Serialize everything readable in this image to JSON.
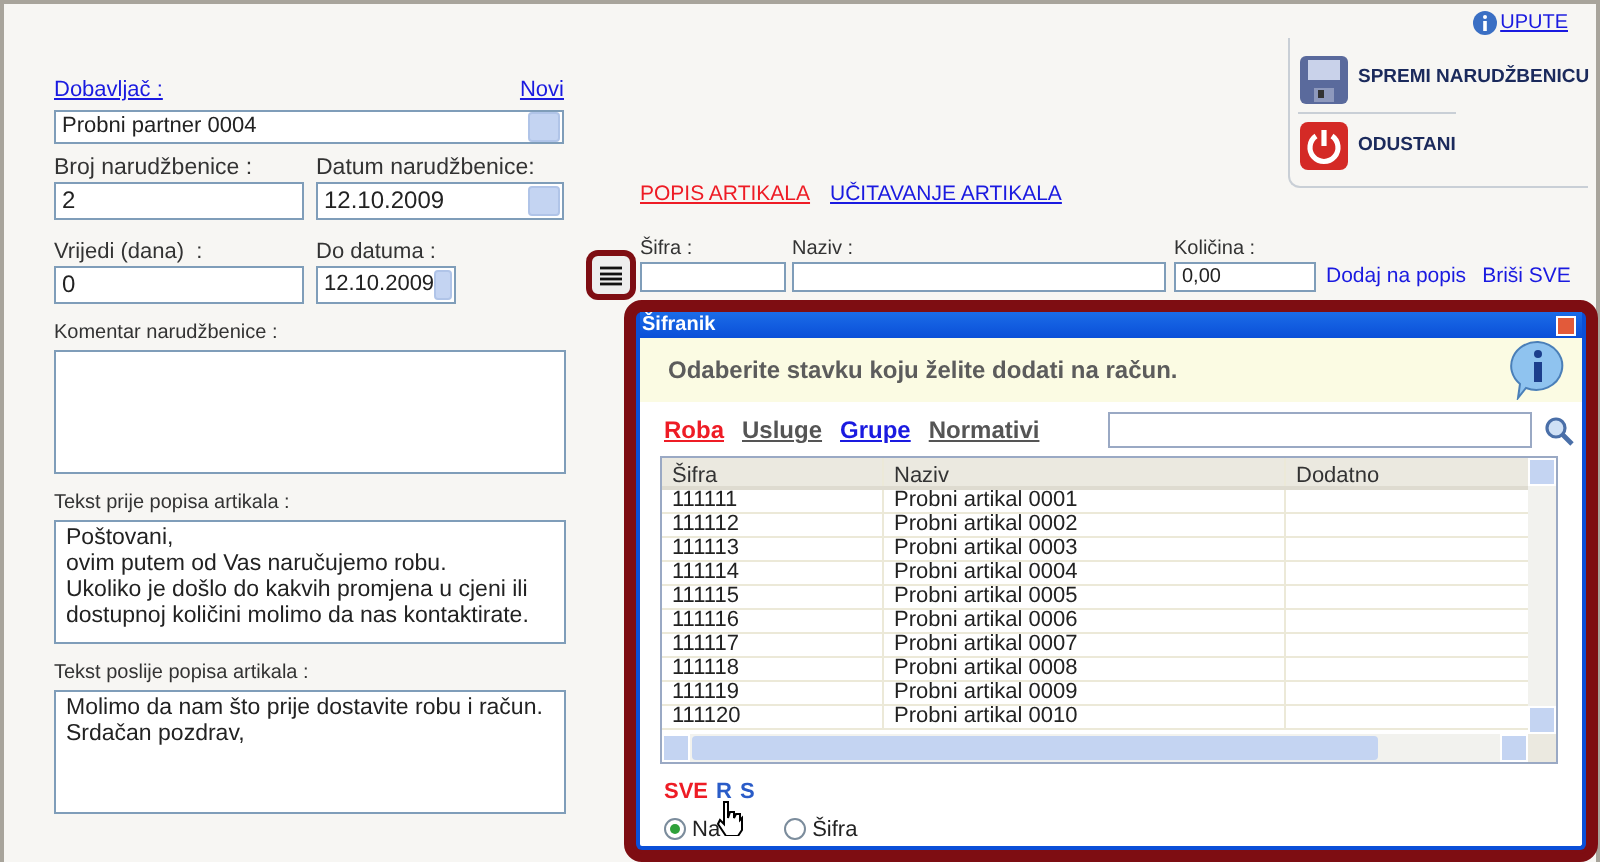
{
  "help_link": "UPUTE",
  "actions": [
    {
      "kind": "save",
      "label": "SPREMI NARUDŽBENICU"
    },
    {
      "kind": "cancel",
      "label": "ODUSTANI"
    }
  ],
  "supplier": {
    "label": "Dobavljač :",
    "new_link": "Novi",
    "value": "Probni partner 0004"
  },
  "order_number": {
    "label": "Broj narudžbenice :",
    "value": "2"
  },
  "order_date": {
    "label": "Datum narudžbenice:",
    "value": "12.10.2009"
  },
  "valid_days": {
    "label": "Vrijedi (dana)  :",
    "value": "0"
  },
  "valid_until": {
    "label": "Do datuma :",
    "value": "12.10.2009"
  },
  "comment": {
    "label": "Komentar narudžbenice :"
  },
  "text_before": {
    "label": "Tekst prije popisa artikala :",
    "value": "Poštovani,\novim putem od Vas naručujemo robu.\nUkoliko je došlo do kakvih promjena u cjeni ili\ndostupnoj količini molimo da nas kontaktirate."
  },
  "text_after": {
    "label": "Tekst poslije popisa artikala :",
    "value": "Molimo da nam što prije dostavite robu i račun.\nSrdačan pozdrav,"
  },
  "tabs": [
    {
      "label": "POPIS ARTIKALA",
      "selected": true
    },
    {
      "label": "UČITAVANJE ARTIKALA",
      "selected": false
    }
  ],
  "item_entry": {
    "code_label": "Šifra :",
    "name_label": "Naziv :",
    "qty_label": "Količina :",
    "qty_value": "0,00",
    "links": [
      "Dodaj na popis",
      "Briši SVE"
    ]
  },
  "dialog": {
    "title": "Šifranik",
    "message": "Odaberite stavku koju želite dodati na račun.",
    "categories": [
      {
        "label": "Roba",
        "selected": true
      },
      {
        "label": "Usluge",
        "selected": false,
        "color": "#555555"
      },
      {
        "label": "Grupe",
        "selected": false,
        "color": "#1a1ae0"
      },
      {
        "label": "Normativi",
        "selected": false,
        "color": "#555555"
      }
    ],
    "columns": [
      "Šifra",
      "Naziv",
      "Dodatno"
    ],
    "rows": [
      {
        "code": "111111",
        "name": "Probni artikal 0001"
      },
      {
        "code": "111112",
        "name": "Probni artikal 0002"
      },
      {
        "code": "111113",
        "name": "Probni artikal 0003"
      },
      {
        "code": "111114",
        "name": "Probni artikal 0004"
      },
      {
        "code": "111115",
        "name": "Probni artikal 0005"
      },
      {
        "code": "111116",
        "name": "Probni artikal 0006"
      },
      {
        "code": "111117",
        "name": "Probni artikal 0007"
      },
      {
        "code": "111118",
        "name": "Probni artikal 0008"
      },
      {
        "code": "111119",
        "name": "Probni artikal 0009"
      },
      {
        "code": "111120",
        "name": "Probni artikal 0010"
      }
    ],
    "letters": [
      {
        "label": "SVE",
        "selected": true
      },
      {
        "label": "R",
        "selected": false
      },
      {
        "label": "S",
        "selected": false
      }
    ],
    "sort_by": [
      {
        "label": "Na",
        "selected": true
      },
      {
        "label": "Šifra",
        "selected": false
      }
    ]
  }
}
